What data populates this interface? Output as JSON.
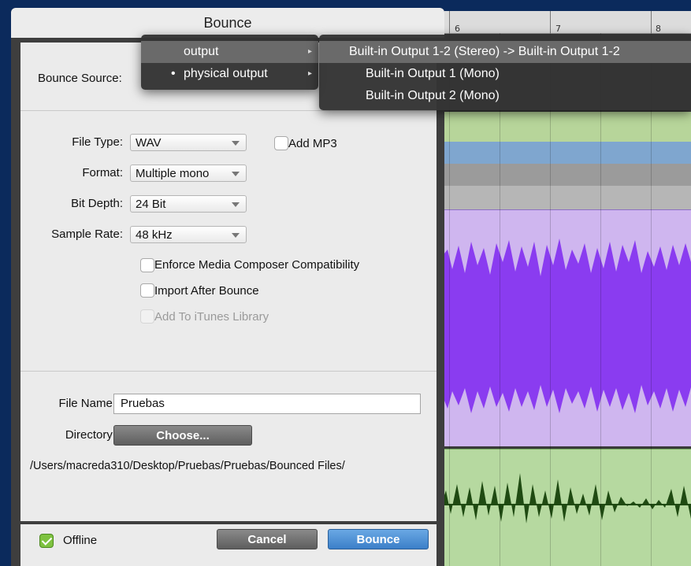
{
  "dialog": {
    "title": "Bounce",
    "bounce_source_label": "Bounce Source:",
    "file_type_label": "File Type:",
    "file_type_value": "WAV",
    "add_mp3_label": "Add MP3",
    "add_mp3_checked": false,
    "format_label": "Format:",
    "format_value": "Multiple mono",
    "bit_depth_label": "Bit Depth:",
    "bit_depth_value": "24 Bit",
    "sample_rate_label": "Sample Rate:",
    "sample_rate_value": "48 kHz",
    "options": [
      {
        "label": "Enforce Media Composer Compatibility",
        "checked": false,
        "enabled": true
      },
      {
        "label": "Import After Bounce",
        "checked": false,
        "enabled": true
      },
      {
        "label": "Add To iTunes Library",
        "checked": false,
        "enabled": false
      }
    ],
    "file_name_label": "File Name:",
    "file_name_value": "Pruebas",
    "directory_label": "Directory:",
    "choose_button": "Choose...",
    "path": "/Users/macreda310/Desktop/Pruebas/Pruebas/Bounced Files/",
    "offline_label": "Offline",
    "offline_checked": true,
    "cancel_button": "Cancel",
    "bounce_button": "Bounce"
  },
  "source_menu": {
    "items": [
      {
        "label": "output",
        "has_submenu": true,
        "highlighted": true,
        "bullet": false
      },
      {
        "label": "physical output",
        "has_submenu": true,
        "highlighted": false,
        "bullet": true
      }
    ],
    "bullet_glyph": "•",
    "submenu_arrow": "▸"
  },
  "output_submenu": {
    "items": [
      {
        "label": "Built-in Output 1-2 (Stereo) -> Built-in Output 1-2",
        "highlighted": true
      },
      {
        "label": "Built-in Output 1 (Mono)",
        "highlighted": false
      },
      {
        "label": "Built-in Output 2 (Mono)",
        "highlighted": false
      }
    ]
  },
  "timeline": {
    "ruler_numbers": [
      "6",
      "7",
      "8"
    ]
  },
  "colors": {
    "accent_blue": "#3b7fc8",
    "offline_check_green": "#7ec240",
    "purple_clip": "#cfb6ef",
    "purple_wave": "#8a3cf0",
    "green_clip": "#b6d9a0",
    "green_wave": "#1f4a12"
  }
}
